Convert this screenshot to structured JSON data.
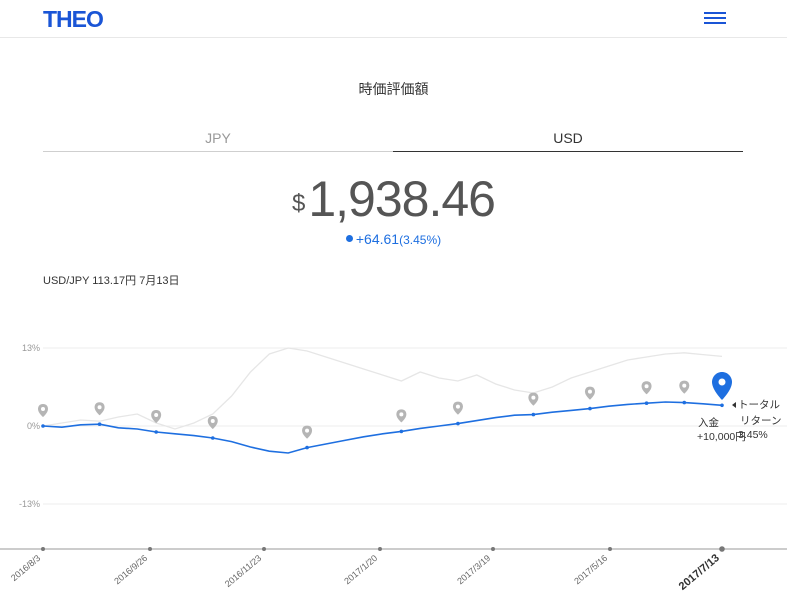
{
  "header": {
    "logo": "THEO",
    "menu_icon": "hamburger-menu-icon"
  },
  "page_title": "時価評価額",
  "tabs": [
    {
      "label": "JPY",
      "active": false
    },
    {
      "label": "USD",
      "active": true
    }
  ],
  "valuation": {
    "currency_symbol": "$",
    "amount": "1,938.46",
    "change": "+64.61",
    "change_pct": "(3.45%)"
  },
  "fx_rate": "USD/JPY 113.17円 7月13日",
  "colors": {
    "brand": "#1a55d6",
    "return_line": "#1e6fe0",
    "benchmark_line": "#e6e6e6",
    "marker": "#b5b5b5"
  },
  "chart_data": {
    "type": "line",
    "y_ticks": [
      "13%",
      "0%",
      "-13%"
    ],
    "ylim": [
      -13,
      13
    ],
    "x_tick_labels": [
      "2016/8/3",
      "2016/9/26",
      "2016/11/23",
      "2017/1/20",
      "2017/3/19",
      "2017/5/16",
      "2017/7/13"
    ],
    "grid": true,
    "legend": "none",
    "series": [
      {
        "values": [
          0,
          -0.2,
          0.2,
          0.3,
          -0.3,
          -0.5,
          -1.0,
          -1.3,
          -1.6,
          -2.0,
          -2.6,
          -3.5,
          -4.2,
          -4.5,
          -3.6,
          -3.0,
          -2.4,
          -1.8,
          -1.3,
          -0.9,
          -0.4,
          0.0,
          0.4,
          0.9,
          1.4,
          1.8,
          1.9,
          2.3,
          2.6,
          2.9,
          3.3,
          3.6,
          3.8,
          4.0,
          3.9,
          3.7,
          3.45
        ]
      },
      {
        "values": [
          0,
          0.5,
          1.0,
          0.8,
          1.5,
          2.0,
          0.5,
          -0.5,
          0.5,
          2.0,
          5.0,
          9.0,
          12.0,
          13.0,
          12.5,
          11.5,
          10.5,
          9.5,
          8.5,
          7.5,
          9.0,
          8.0,
          7.5,
          8.5,
          7.0,
          6.0,
          5.5,
          6.5,
          8.0,
          9.0,
          10.0,
          11.0,
          11.5,
          12.0,
          12.2,
          11.9,
          11.6
        ]
      }
    ],
    "annotations": [
      {
        "date": "2017/7/13",
        "labels": [
          "トータル",
          "リターン",
          "3.45%"
        ]
      },
      {
        "date": "2017/7/13",
        "labels": [
          "入金",
          "+10,000円"
        ]
      }
    ]
  }
}
